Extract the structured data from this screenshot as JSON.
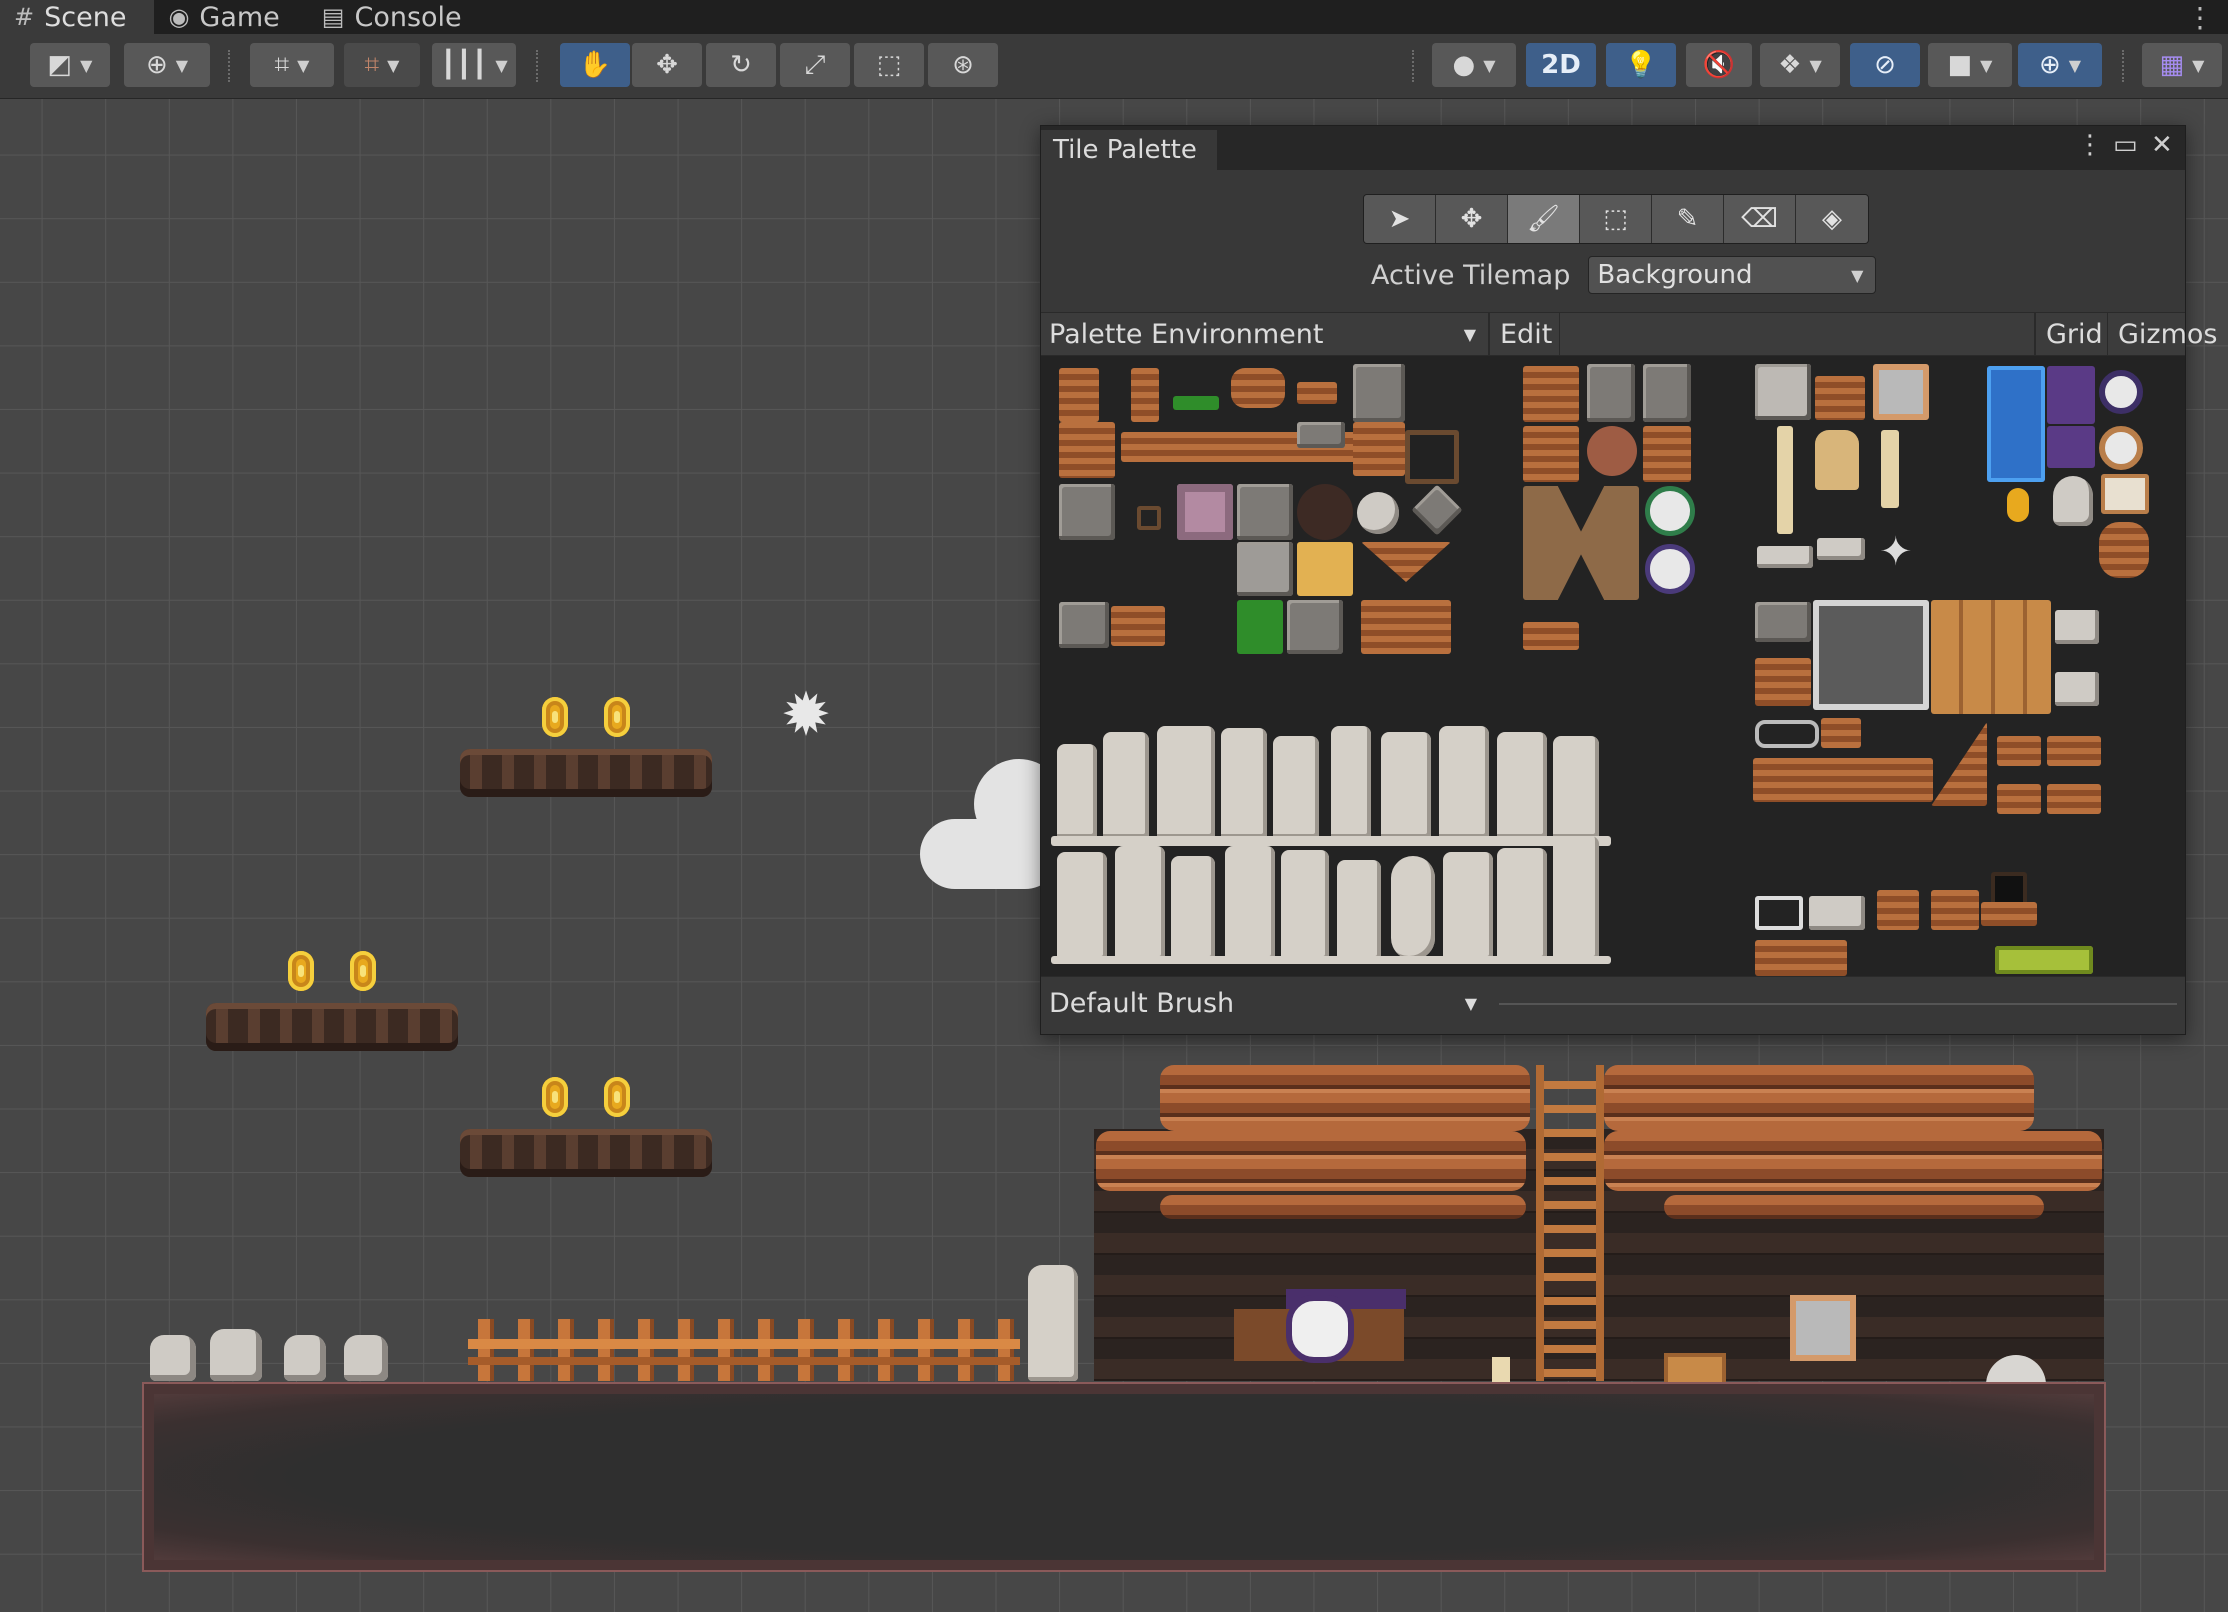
{
  "tabs": [
    {
      "label": "Scene",
      "icon": "grid-hash-icon"
    },
    {
      "label": "Game",
      "icon": "gamepad-icon"
    },
    {
      "label": "Console",
      "icon": "console-list-icon"
    }
  ],
  "toolbar": {
    "view_2d_label": "2D"
  },
  "tile_palette": {
    "title": "Tile Palette",
    "active_tilemap_label": "Active Tilemap",
    "active_tilemap_value": "Background",
    "palette_name": "Palette Environment",
    "edit_label": "Edit",
    "grid_label": "Grid",
    "gizmos_label": "Gizmos",
    "brush_name": "Default Brush",
    "tools": [
      "select-arrow-icon",
      "move-icon",
      "paint-brush-icon",
      "box-fill-icon",
      "eyedropper-icon",
      "eraser-icon",
      "flood-fill-icon"
    ],
    "active_tool": "paint-brush-icon"
  },
  "colors": {
    "accent_blue": "#3e5f8a",
    "scene_bg": "#474747",
    "panel_bg": "#383838",
    "ground_border": "#8b5a5a"
  }
}
